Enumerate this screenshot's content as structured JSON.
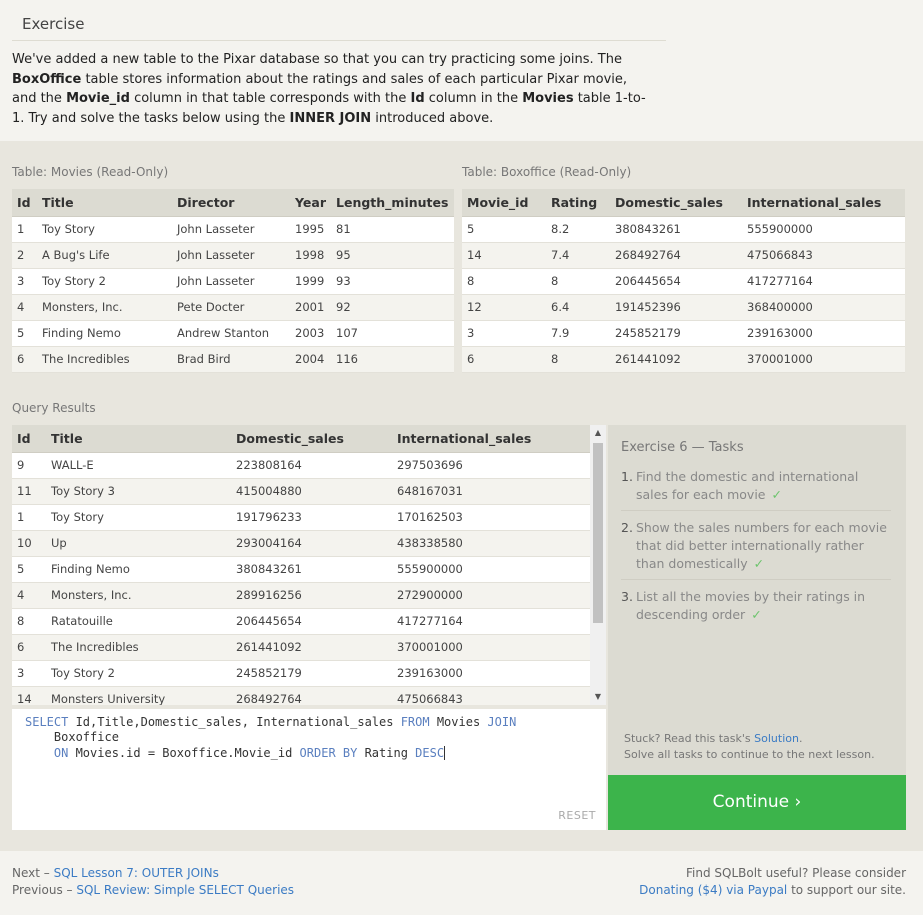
{
  "exercise": {
    "heading": "Exercise",
    "intro": {
      "p1": "We've added a new table to the Pixar database so that you can try practicing some joins. The ",
      "b1": "BoxOffice",
      "p2": " table stores information about the ratings and sales of each particular Pixar movie, and the ",
      "b2": "Movie_id",
      "p3": " column in that table corresponds with the ",
      "b3": "Id",
      "p4": " column in the ",
      "b4": "Movies",
      "p5": " table 1-to-1. Try and solve the tasks below using the ",
      "b5": "INNER JOIN",
      "p6": " introduced above."
    }
  },
  "movies_table": {
    "label": "Table: Movies (Read-Only)",
    "headers": [
      "Id",
      "Title",
      "Director",
      "Year",
      "Length_minutes"
    ],
    "rows": [
      [
        "1",
        "Toy Story",
        "John Lasseter",
        "1995",
        "81"
      ],
      [
        "2",
        "A Bug's Life",
        "John Lasseter",
        "1998",
        "95"
      ],
      [
        "3",
        "Toy Story 2",
        "John Lasseter",
        "1999",
        "93"
      ],
      [
        "4",
        "Monsters, Inc.",
        "Pete Docter",
        "2001",
        "92"
      ],
      [
        "5",
        "Finding Nemo",
        "Andrew Stanton",
        "2003",
        "107"
      ],
      [
        "6",
        "The Incredibles",
        "Brad Bird",
        "2004",
        "116"
      ]
    ]
  },
  "boxoffice_table": {
    "label": "Table: Boxoffice (Read-Only)",
    "headers": [
      "Movie_id",
      "Rating",
      "Domestic_sales",
      "International_sales"
    ],
    "rows": [
      [
        "5",
        "8.2",
        "380843261",
        "555900000"
      ],
      [
        "14",
        "7.4",
        "268492764",
        "475066843"
      ],
      [
        "8",
        "8",
        "206445654",
        "417277164"
      ],
      [
        "12",
        "6.4",
        "191452396",
        "368400000"
      ],
      [
        "3",
        "7.9",
        "245852179",
        "239163000"
      ],
      [
        "6",
        "8",
        "261441092",
        "370001000"
      ]
    ]
  },
  "results": {
    "label": "Query Results",
    "headers": [
      "Id",
      "Title",
      "Domestic_sales",
      "International_sales"
    ],
    "rows": [
      [
        "9",
        "WALL-E",
        "223808164",
        "297503696"
      ],
      [
        "11",
        "Toy Story 3",
        "415004880",
        "648167031"
      ],
      [
        "1",
        "Toy Story",
        "191796233",
        "170162503"
      ],
      [
        "10",
        "Up",
        "293004164",
        "438338580"
      ],
      [
        "5",
        "Finding Nemo",
        "380843261",
        "555900000"
      ],
      [
        "4",
        "Monsters, Inc.",
        "289916256",
        "272900000"
      ],
      [
        "8",
        "Ratatouille",
        "206445654",
        "417277164"
      ],
      [
        "6",
        "The Incredibles",
        "261441092",
        "370001000"
      ],
      [
        "3",
        "Toy Story 2",
        "245852179",
        "239163000"
      ],
      [
        "14",
        "Monsters University",
        "268492764",
        "475066843"
      ]
    ]
  },
  "editor": {
    "line1_kw1": "SELECT",
    "line1_text": " Id,Title,Domestic_sales, International_sales ",
    "line1_kw2": "FROM",
    "line1_text2": " Movies ",
    "line1_kw3": "JOIN",
    "line2_text": "    Boxoffice",
    "line3_indent": "    ",
    "line3_kw1": "ON",
    "line3_text": " Movies.id = Boxoffice.Movie_id ",
    "line3_kw2": "ORDER BY",
    "line3_text2": " Rating ",
    "line3_kw3": "DESC",
    "reset_label": "RESET"
  },
  "tasks": {
    "title": "Exercise 6 — Tasks",
    "items": [
      {
        "num": "1.",
        "text": "Find the domestic and international sales for each movie",
        "check": "✓"
      },
      {
        "num": "2.",
        "text": "Show the sales numbers for each movie that did better internationally rather than domestically",
        "check": "✓"
      },
      {
        "num": "3.",
        "text": "List all the movies by their ratings in descending order",
        "check": "✓"
      }
    ],
    "stuck_prefix": "Stuck? Read this task's ",
    "solution_link": "Solution",
    "stuck_suffix": ".",
    "solve_all": "Solve all tasks to continue to the next lesson.",
    "continue_label": "Continue ›"
  },
  "footer": {
    "next_prefix": "Next – ",
    "next_link": "SQL Lesson 7: OUTER JOINs",
    "prev_prefix": "Previous – ",
    "prev_link": "SQL Review: Simple SELECT Queries",
    "useful": "Find SQLBolt useful? Please consider",
    "donate_link": "Donating ($4) via Paypal",
    "donate_suffix": " to support our site."
  },
  "colors": {
    "continue_bg": "#3cb44b",
    "link": "#3b7bc4",
    "keyword": "#5a7fbf",
    "check": "#6bc46b"
  }
}
